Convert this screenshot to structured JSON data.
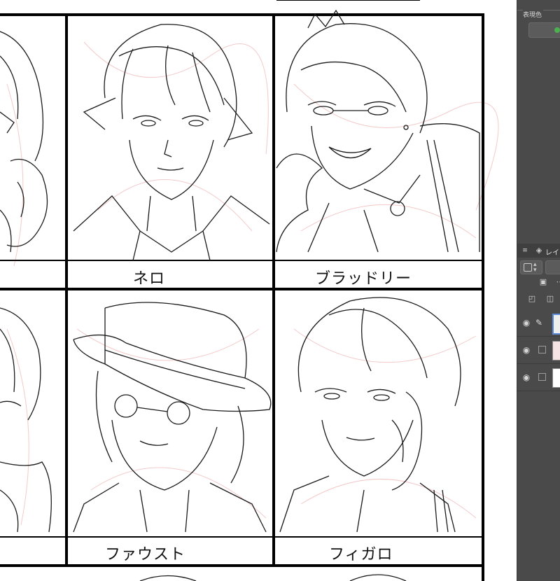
{
  "canvas": {
    "names": [
      "ネロ",
      "ブラッドリー",
      "ファウスト",
      "フィガロ"
    ]
  },
  "panel": {
    "color_header": "表現色",
    "layers_tab_label": "レイ",
    "menu_icon": "hamburger-icon",
    "layers": [
      {
        "name": "sketch-layer",
        "active": true
      },
      {
        "name": "draft-layer",
        "active": false
      },
      {
        "name": "paper-layer",
        "active": false
      }
    ]
  },
  "colors": {
    "panel_bg": "#4a4a4a",
    "toggle_green": "#4caf50",
    "active_layer_border": "#5b8ad8"
  }
}
